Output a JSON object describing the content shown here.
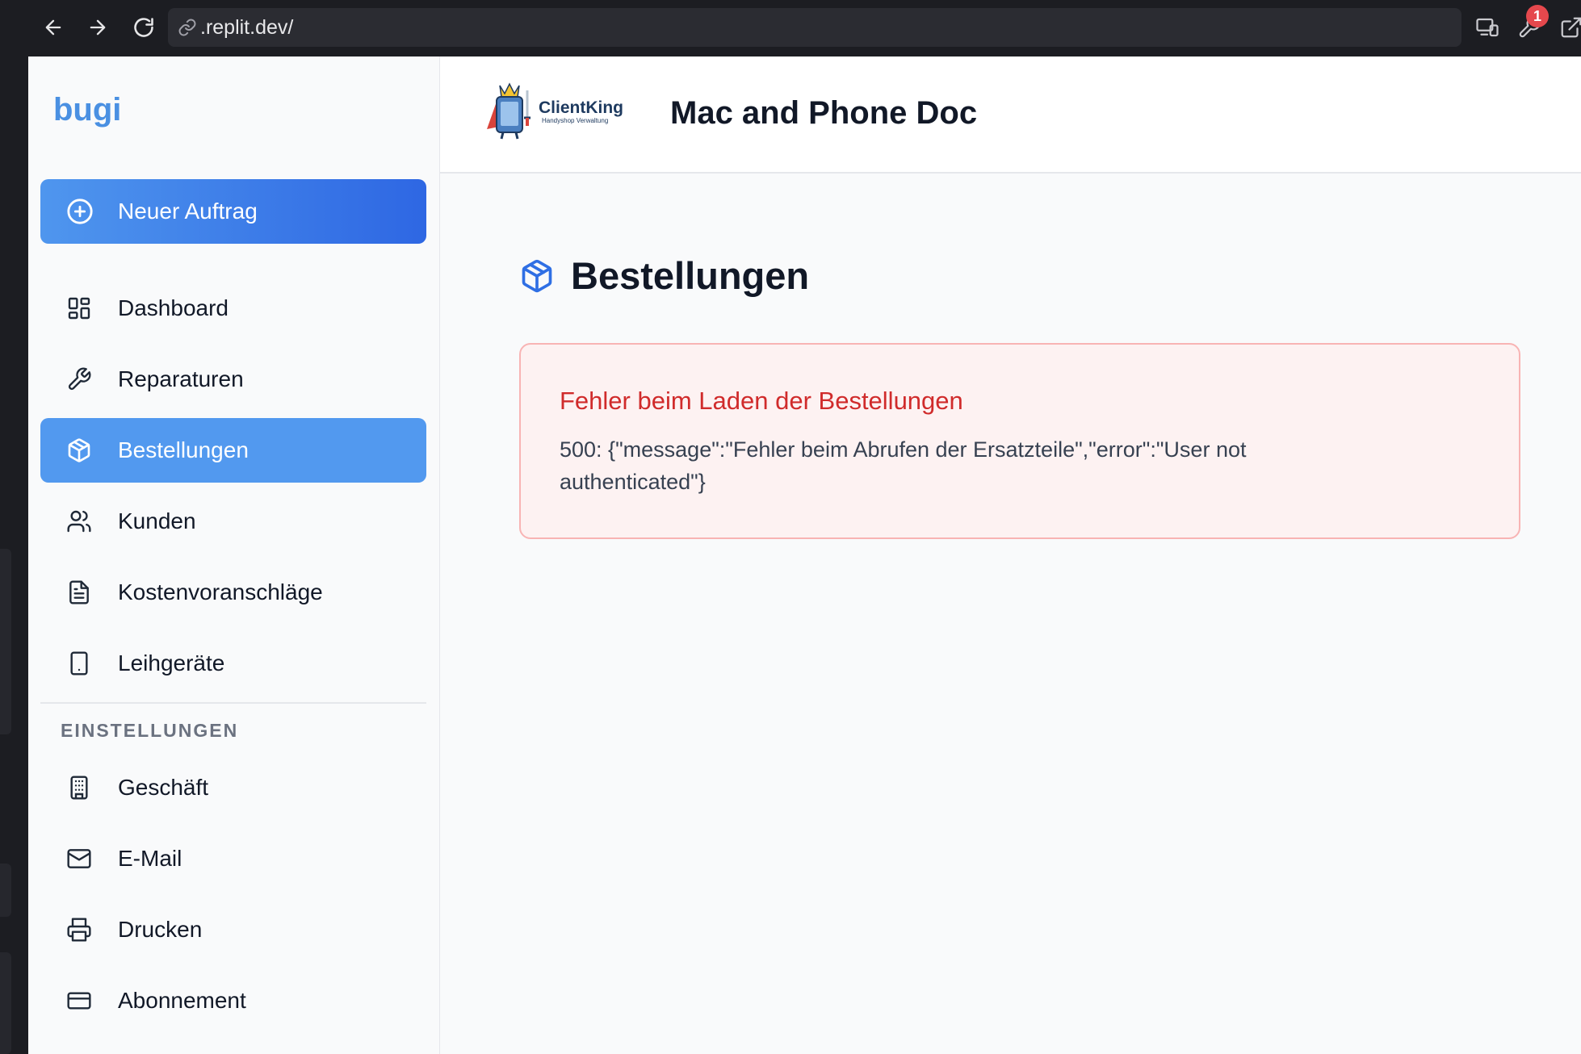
{
  "browser": {
    "url": ".replit.dev/",
    "badge_count": "1"
  },
  "sidebar": {
    "brand": "bugi",
    "primary_action": "Neuer Auftrag",
    "items": [
      {
        "label": "Dashboard",
        "icon": "dashboard-icon"
      },
      {
        "label": "Reparaturen",
        "icon": "wrench-icon"
      },
      {
        "label": "Bestellungen",
        "icon": "package-icon",
        "active": true
      },
      {
        "label": "Kunden",
        "icon": "users-icon"
      },
      {
        "label": "Kostenvoranschläge",
        "icon": "file-text-icon"
      },
      {
        "label": "Leihgeräte",
        "icon": "tablet-icon"
      }
    ],
    "settings_label": "EINSTELLUNGEN",
    "settings_items": [
      {
        "label": "Geschäft",
        "icon": "building-icon"
      },
      {
        "label": "E-Mail",
        "icon": "mail-icon"
      },
      {
        "label": "Drucken",
        "icon": "printer-icon"
      },
      {
        "label": "Abonnement",
        "icon": "credit-card-icon"
      }
    ]
  },
  "header": {
    "logo_text": "ClientKing",
    "logo_subtext": "Handyshop Verwaltung",
    "shop_name": "Mac and Phone Doc"
  },
  "main": {
    "title": "Bestellungen",
    "error": {
      "title": "Fehler beim Laden der Bestellungen",
      "message": "500: {\"message\":\"Fehler beim Abrufen der Ersatzteile\",\"error\":\"User not authenticated\"}"
    }
  },
  "colors": {
    "brand": "#4a90e2",
    "primary_gradient_start": "#4f96ee",
    "primary_gradient_end": "#2e67e3",
    "active_item": "#5299ef",
    "error_text": "#d02b2b",
    "error_bg": "#fdf2f2"
  }
}
